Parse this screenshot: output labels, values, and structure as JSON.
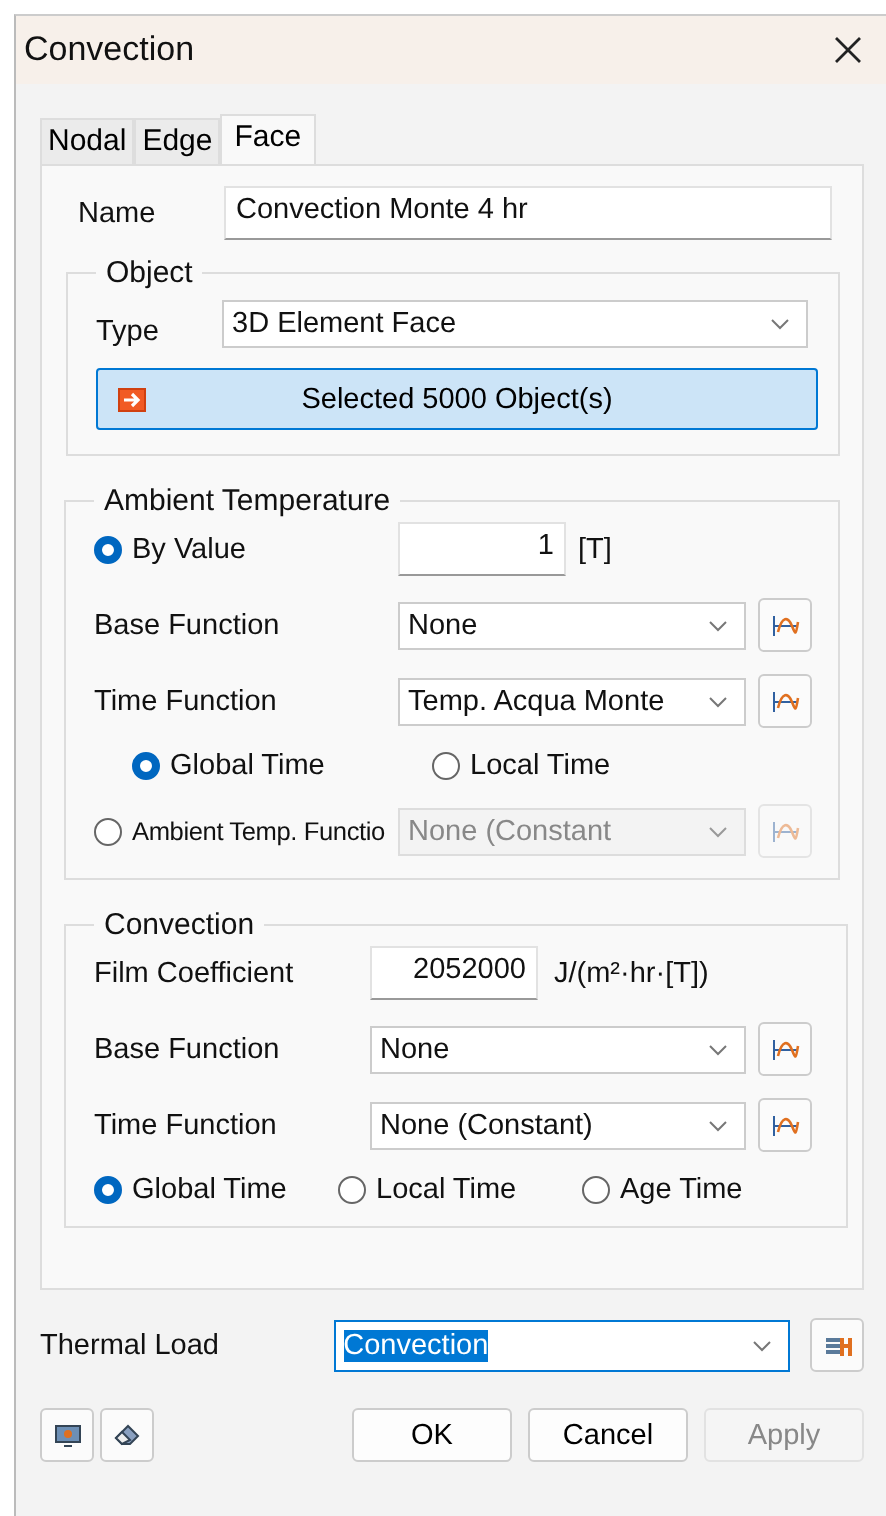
{
  "window": {
    "title": "Convection"
  },
  "tabs": [
    {
      "label": "Nodal",
      "selected": false
    },
    {
      "label": "Edge",
      "selected": false
    },
    {
      "label": "Face",
      "selected": true
    }
  ],
  "name": {
    "label": "Name",
    "value": "Convection Monte 4 hr"
  },
  "object": {
    "legend": "Object",
    "type_label": "Type",
    "type_value": "3D Element Face",
    "select_button": "Selected 5000 Object(s)"
  },
  "ambient": {
    "legend": "Ambient Temperature",
    "by_value": {
      "label": "By Value",
      "selected": true,
      "value": "1",
      "unit": "[T]"
    },
    "base_function": {
      "label": "Base Function",
      "value": "None"
    },
    "time_function": {
      "label": "Time Function",
      "value": "Temp. Acqua Monte"
    },
    "time_options": [
      {
        "label": "Global Time",
        "selected": true
      },
      {
        "label": "Local Time",
        "selected": false
      }
    ],
    "function_option": {
      "label": "Ambient Temp. Functio",
      "selected": false,
      "value": "None (Constant",
      "disabled": true
    }
  },
  "convection": {
    "legend": "Convection",
    "film": {
      "label": "Film Coefficient",
      "value": "2052000",
      "unit": "J/(m²·hr·[T])"
    },
    "base_function": {
      "label": "Base Function",
      "value": "None"
    },
    "time_function": {
      "label": "Time Function",
      "value": "None (Constant)"
    },
    "time_options": [
      {
        "label": "Global Time",
        "selected": true
      },
      {
        "label": "Local Time",
        "selected": false
      },
      {
        "label": "Age Time",
        "selected": false
      }
    ]
  },
  "thermal_load": {
    "label": "Thermal Load",
    "value": "Convection",
    "text_selected": true
  },
  "buttons": [
    {
      "label": "OK",
      "disabled": false
    },
    {
      "label": "Cancel",
      "disabled": false
    },
    {
      "label": "Apply",
      "disabled": true
    }
  ]
}
